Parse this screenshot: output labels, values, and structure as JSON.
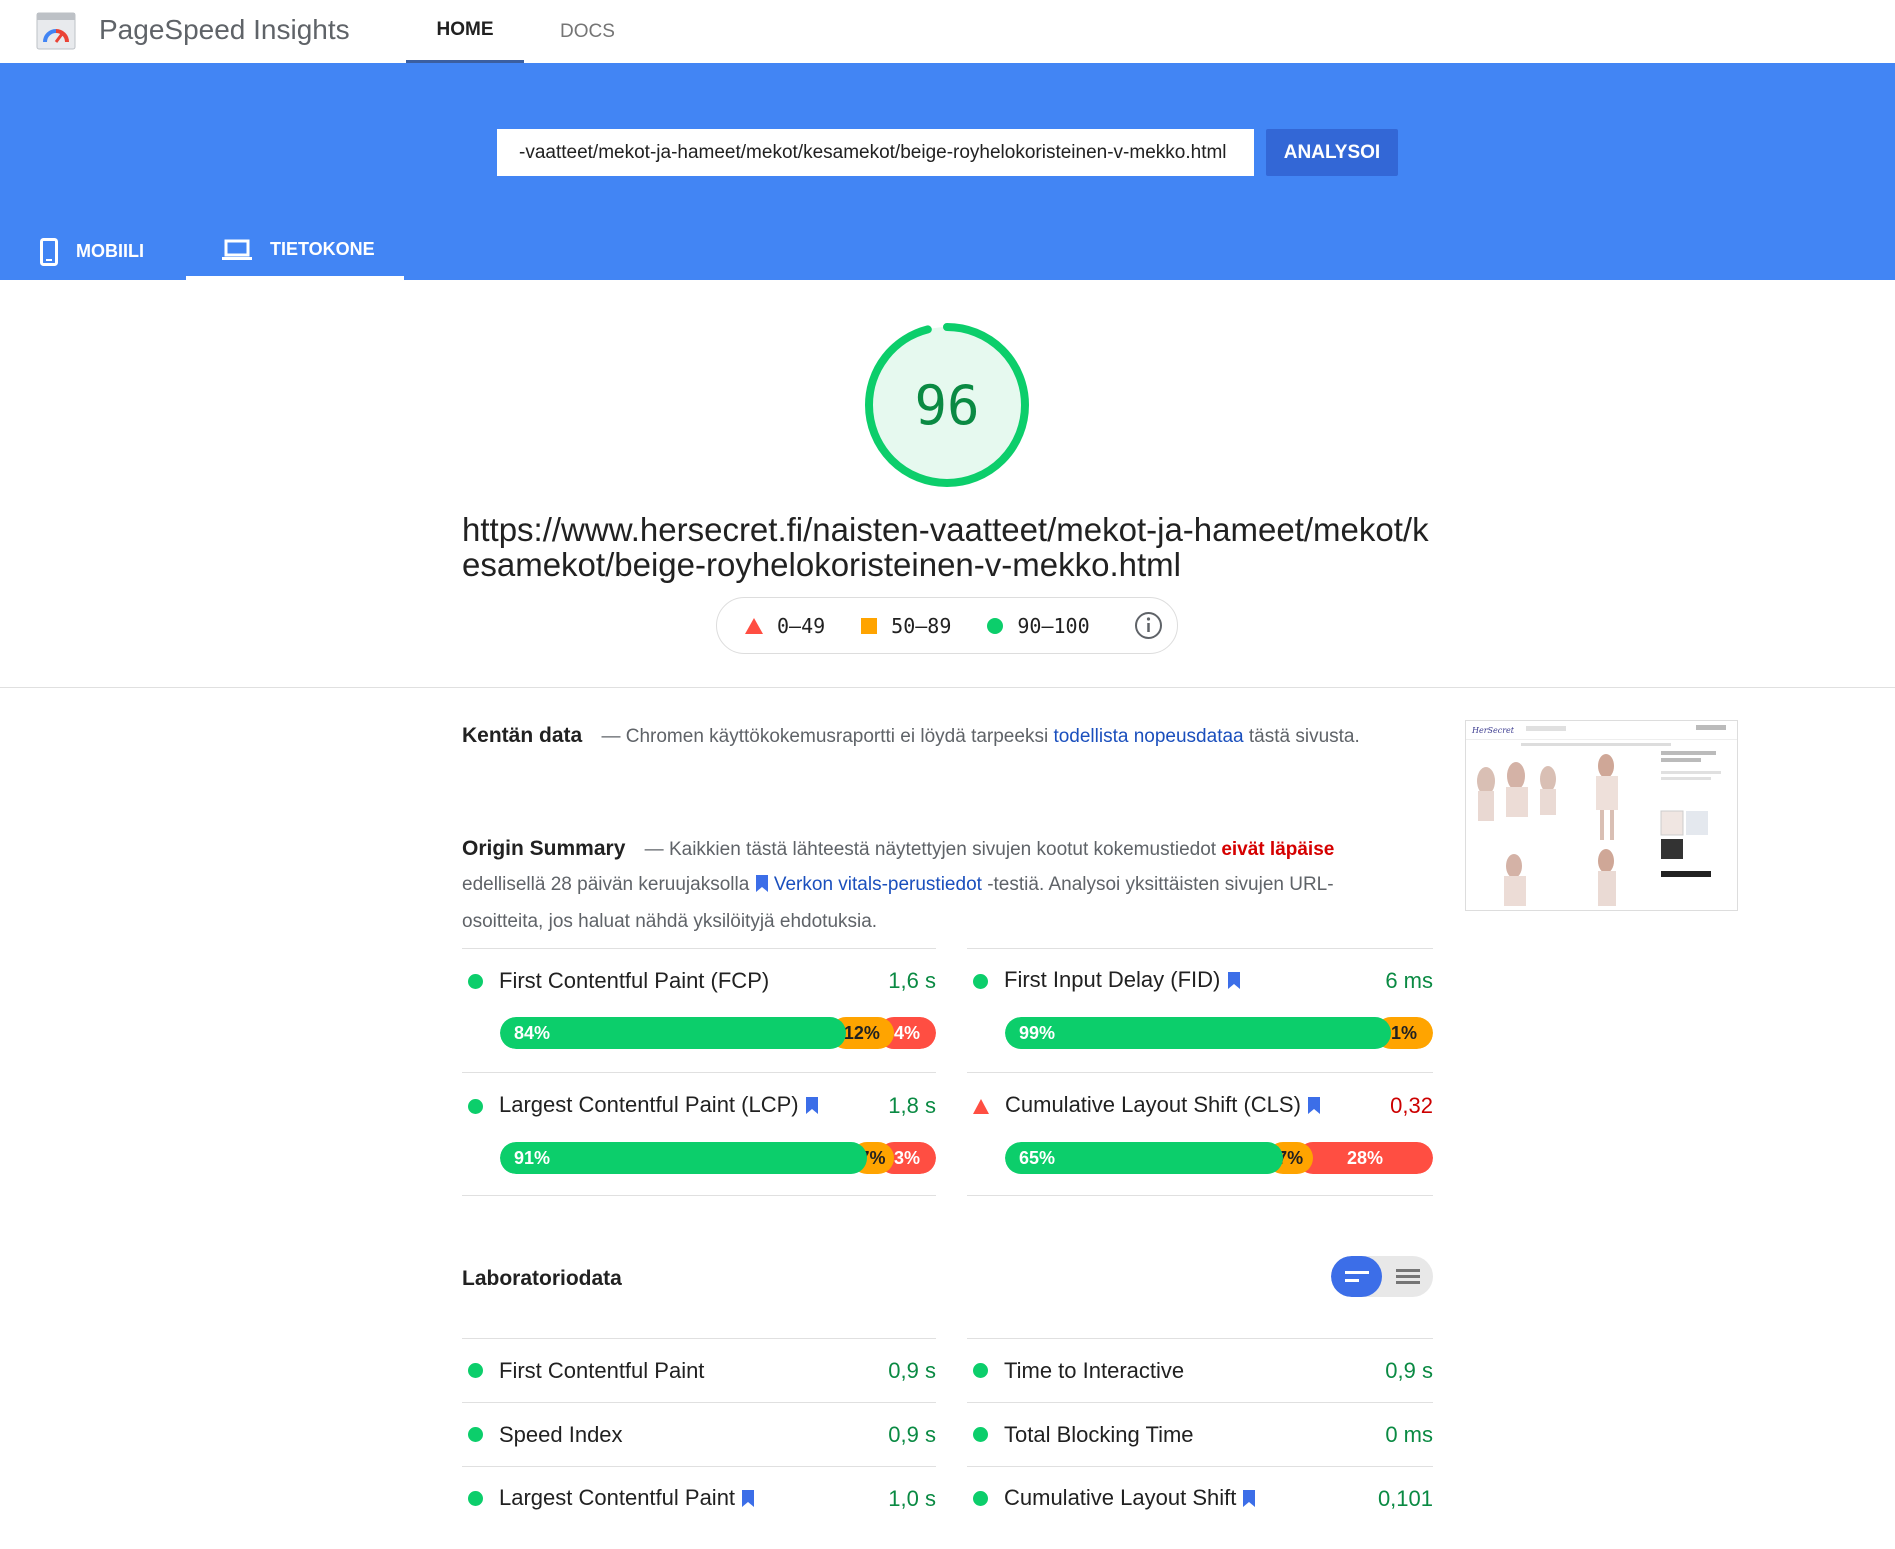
{
  "app": {
    "title": "PageSpeed Insights"
  },
  "nav": {
    "tabs": [
      "HOME",
      "DOCS"
    ],
    "active": "HOME"
  },
  "search": {
    "value": "-vaatteet/mekot-ja-hameet/mekot/kesamekot/beige-royhelokoristeinen-v-mekko.html",
    "button_label": "ANALYSOI"
  },
  "device_tabs": [
    {
      "label": "MOBIILI",
      "icon": "smartphone-icon",
      "active": false
    },
    {
      "label": "TIETOKONE",
      "icon": "laptop-icon",
      "active": true
    }
  ],
  "score": {
    "value": "96",
    "fraction": 0.96,
    "color": "#0cce6b"
  },
  "page_url": "https://www.hersecret.fi/naisten-vaatteet/mekot-ja-hameet/mekot/kesamekot/beige-royhelokoristeinen-v-mekko.html",
  "legend": [
    {
      "range": "0–49",
      "shape": "triangle",
      "color": "#ff4e42"
    },
    {
      "range": "50–89",
      "shape": "square",
      "color": "#ffa400"
    },
    {
      "range": "90–100",
      "shape": "circle",
      "color": "#0cce6b"
    }
  ],
  "field_data": {
    "title": "Kentän data",
    "text_before": "— Chromen käyttökokemusraportti ei löydä tarpeeksi",
    "link": "todellista nopeusdataa",
    "text_after": "tästä sivusta."
  },
  "origin_summary": {
    "title": "Origin Summary",
    "text_before": "— Kaikkien tästä lähteestä näytettyjen sivujen kootut kokemustiedot",
    "fail_text": "eivät läpäise",
    "text_middle": "edellisellä 28 päivän keruujaksolla",
    "link": "Verkon vitals-perustiedot",
    "text_after": "-testiä. Analysoi yksittäisten sivujen URL-osoitteita, jos haluat nähdä yksilöityjä ehdotuksia.",
    "metrics": [
      {
        "name": "First Contentful Paint (FCP)",
        "value": "1,6 s",
        "status": "good",
        "bookmark": false,
        "dist": [
          {
            "pct": 84,
            "label": "84%"
          },
          {
            "pct": 12,
            "label": "12%"
          },
          {
            "pct": 4,
            "label": "4%"
          }
        ]
      },
      {
        "name": "First Input Delay (FID)",
        "value": "6 ms",
        "status": "good",
        "bookmark": true,
        "dist": [
          {
            "pct": 99,
            "label": "99%"
          },
          {
            "pct": 1,
            "label": "1%"
          },
          {
            "pct": 0,
            "label": ""
          }
        ]
      },
      {
        "name": "Largest Contentful Paint (LCP)",
        "value": "1,8 s",
        "status": "good",
        "bookmark": true,
        "dist": [
          {
            "pct": 91,
            "label": "91%"
          },
          {
            "pct": 7,
            "label": "7%"
          },
          {
            "pct": 3,
            "label": "3%"
          }
        ]
      },
      {
        "name": "Cumulative Layout Shift (CLS)",
        "value": "0,32",
        "status": "bad",
        "bookmark": true,
        "dist": [
          {
            "pct": 65,
            "label": "65%"
          },
          {
            "pct": 7,
            "label": "7%"
          },
          {
            "pct": 28,
            "label": "28%"
          }
        ]
      }
    ]
  },
  "lab_data": {
    "title": "Laboratoriodata",
    "metrics": [
      {
        "name": "First Contentful Paint",
        "value": "0,9 s",
        "bookmark": false
      },
      {
        "name": "Time to Interactive",
        "value": "0,9 s",
        "bookmark": false
      },
      {
        "name": "Speed Index",
        "value": "0,9 s",
        "bookmark": false
      },
      {
        "name": "Total Blocking Time",
        "value": "0 ms",
        "bookmark": false
      },
      {
        "name": "Largest Contentful Paint",
        "value": "1,0 s",
        "bookmark": true
      },
      {
        "name": "Cumulative Layout Shift",
        "value": "0,101",
        "bookmark": true
      }
    ]
  },
  "colors": {
    "brand_blue": "#4285f4",
    "button_blue": "#3367d6",
    "good": "#0cce6b",
    "average": "#ffa400",
    "poor": "#ff4e42",
    "link": "#1a4fbd"
  }
}
